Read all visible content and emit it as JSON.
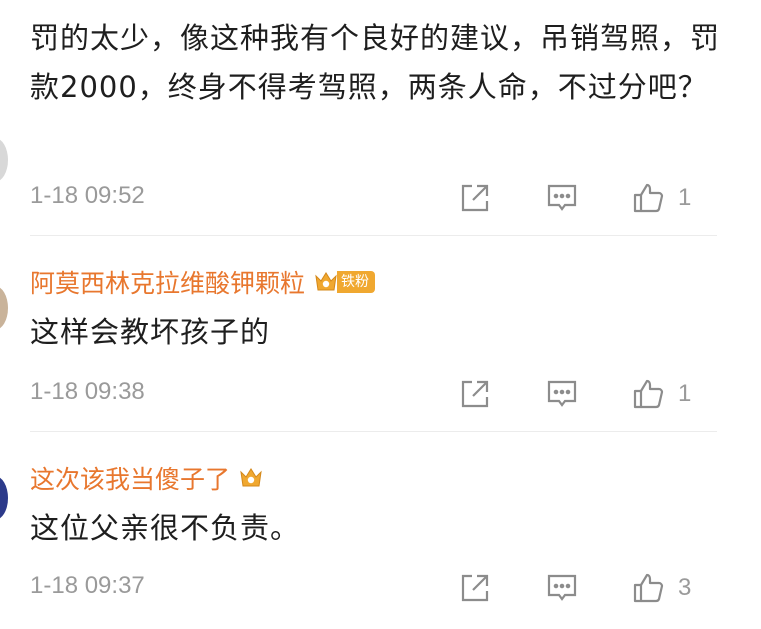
{
  "comments": [
    {
      "username": "",
      "content": "罚的太少，像这种我有个良好的建议，吊销驾照，罚款2000，终身不得考驾照，两条人命，不过分吧？",
      "time": "1-18 09:52",
      "likes": "1"
    },
    {
      "username": "阿莫西林克拉维酸钾颗粒",
      "badge_text": "铁粉",
      "content": "这样会教坏孩子的",
      "time": "1-18 09:38",
      "likes": "1"
    },
    {
      "username": "这次该我当傻子了",
      "content": "这位父亲很不负责。",
      "time": "1-18 09:37",
      "likes": "3"
    }
  ],
  "colors": {
    "username": "#e8772e",
    "badge": "#f0a830",
    "meta": "#9a9a9a"
  },
  "icons": [
    "share-icon",
    "comment-icon",
    "like-icon",
    "crown-icon"
  ]
}
